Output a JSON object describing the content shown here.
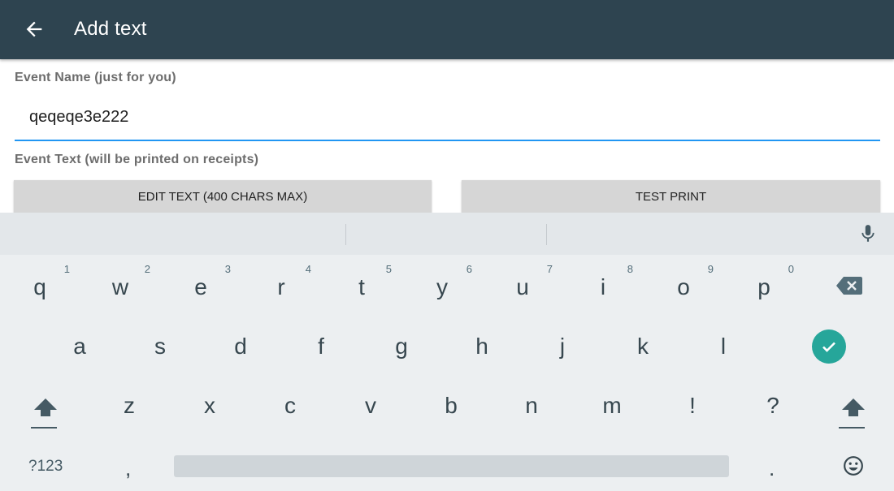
{
  "appbar": {
    "title": "Add text",
    "back_icon": "arrow-back-icon"
  },
  "form": {
    "event_name_label": "Event Name (just for you)",
    "event_name_value": "qeqeqe3e222",
    "event_text_label": "Event Text (will be printed on receipts)",
    "edit_button": "EDIT TEXT (400 CHARS MAX)",
    "test_button": "TEST PRINT",
    "accent_color": "#2196f3"
  },
  "keyboard": {
    "row1": [
      {
        "ch": "q",
        "num": "1"
      },
      {
        "ch": "w",
        "num": "2"
      },
      {
        "ch": "e",
        "num": "3"
      },
      {
        "ch": "r",
        "num": "4"
      },
      {
        "ch": "t",
        "num": "5"
      },
      {
        "ch": "y",
        "num": "6"
      },
      {
        "ch": "u",
        "num": "7"
      },
      {
        "ch": "i",
        "num": "8"
      },
      {
        "ch": "o",
        "num": "9"
      },
      {
        "ch": "p",
        "num": "0"
      }
    ],
    "row2": [
      "a",
      "s",
      "d",
      "f",
      "g",
      "h",
      "j",
      "k",
      "l"
    ],
    "row3": [
      "z",
      "x",
      "c",
      "v",
      "b",
      "n",
      "m",
      "!",
      "?"
    ],
    "symbols_key": "?123",
    "comma_key": ",",
    "period_key": ".",
    "done_color": "#26a69a"
  }
}
